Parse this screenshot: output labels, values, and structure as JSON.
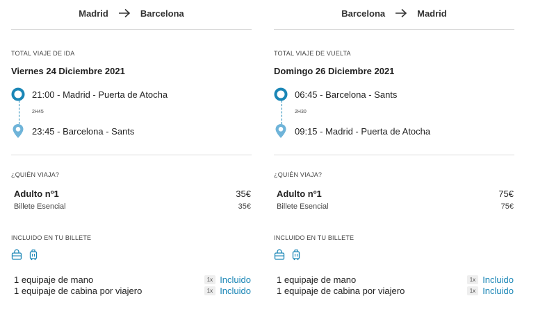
{
  "outbound": {
    "origin": "Madrid",
    "destination": "Barcelona",
    "total_label": "TOTAL VIAJE DE IDA",
    "date": "Viernes 24 Diciembre 2021",
    "departure": "21:00 - Madrid - Puerta de Atocha",
    "duration": "2H45",
    "arrival": "23:45 - Barcelona - Sants",
    "who_label": "¿QUIÉN VIAJA?",
    "passenger_name": "Adulto nº1",
    "passenger_price": "35€",
    "ticket_type": "Billete Esencial",
    "ticket_price": "35€",
    "included_label": "INCLUIDO EN TU BILLETE",
    "bag1_desc": "1 equipaje de mano",
    "bag1_qty": "1x",
    "bag1_status": "Incluido",
    "bag2_desc": "1 equipaje de cabina por viajero",
    "bag2_qty": "1x",
    "bag2_status": "Incluido"
  },
  "return": {
    "origin": "Barcelona",
    "destination": "Madrid",
    "total_label": "TOTAL VIAJE DE VUELTA",
    "date": "Domingo 26 Diciembre 2021",
    "departure": "06:45 - Barcelona - Sants",
    "duration": "2H30",
    "arrival": "09:15 - Madrid - Puerta de Atocha",
    "who_label": "¿QUIÉN VIAJA?",
    "passenger_name": "Adulto nº1",
    "passenger_price": "75€",
    "ticket_type": "Billete Esencial",
    "ticket_price": "75€",
    "included_label": "INCLUIDO EN TU BILLETE",
    "bag1_desc": "1 equipaje de mano",
    "bag1_qty": "1x",
    "bag1_status": "Incluido",
    "bag2_desc": "1 equipaje de cabina por viajero",
    "bag2_qty": "1x",
    "bag2_status": "Incluido"
  },
  "icons": {
    "route_arrow": "arrow-right-icon",
    "departure_marker": "origin-circle-icon",
    "arrival_marker": "map-pin-icon",
    "hand_luggage": "handbag-icon",
    "cabin_luggage": "suitcase-icon"
  },
  "colors": {
    "accent": "#1a86b6",
    "pin": "#6fb4d9",
    "divider": "#dadada"
  }
}
